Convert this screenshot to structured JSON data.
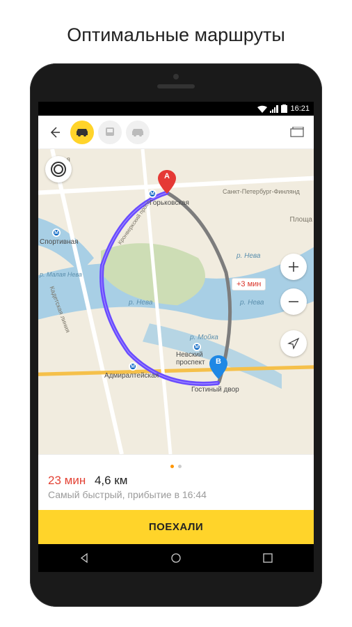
{
  "page_title": "Оптимальные маршруты",
  "status": {
    "time": "16:21"
  },
  "route": {
    "time": "23 мин",
    "distance": "4,6 км",
    "subtitle": "Самый быстрый, прибытие в 16:44",
    "go_label": "ПОЕХАЛИ",
    "traffic_delta": "+3 мин"
  },
  "markers": {
    "a": "A",
    "b": "B"
  },
  "map_labels": {
    "gorkovskaya": "Горьковская",
    "sportivnaya": "Спортивная",
    "nevsky": "Невский\nпроспект",
    "admiralteyskaya": "Адмиралтейская",
    "gostiny": "Гостиный двор",
    "spb_finland": "Санкт-Петербург-Финлянд",
    "ploshchad": "Площа",
    "neva1": "р. Нева",
    "neva2": "р. Нева",
    "neva3": "р. Нева",
    "moika": "р. Мойка",
    "malaya_neva": "р. Малая Нева",
    "kadet": "Кадетская линия",
    "partial": "ая",
    "kronverk": "Кронверкский просп."
  }
}
